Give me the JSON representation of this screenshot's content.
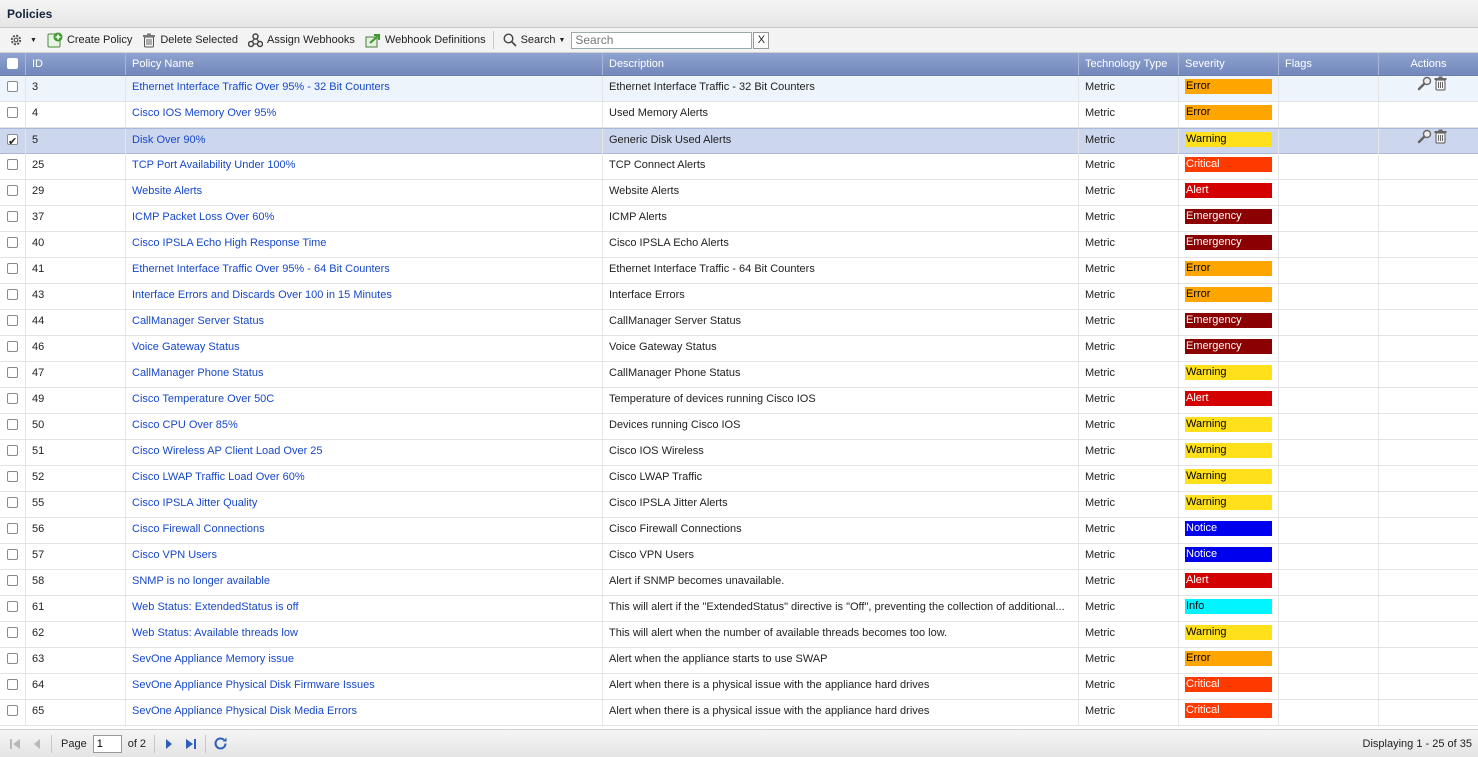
{
  "panel": {
    "title": "Policies"
  },
  "toolbar": {
    "create_label": "Create Policy",
    "delete_label": "Delete Selected",
    "assign_webhooks_label": "Assign Webhooks",
    "webhook_definitions_label": "Webhook Definitions",
    "search_menu_label": "Search",
    "search_placeholder": "Search",
    "search_clear": "X"
  },
  "columns": {
    "id": "ID",
    "name": "Policy Name",
    "description": "Description",
    "tech": "Technology Type",
    "severity": "Severity",
    "flags": "Flags",
    "actions": "Actions"
  },
  "severity_colors": {
    "Error": "#ffa500",
    "Warning": "#ffe01a",
    "Critical": "#ff3a00",
    "Alert": "#d40000",
    "Emergency": "#8b0000",
    "Notice": "#0000ee",
    "Info": "#00f5ff"
  },
  "rows": [
    {
      "id": "3",
      "name": "Ethernet Interface Traffic Over 95% - 32 Bit Counters",
      "description": "Ethernet Interface Traffic - 32 Bit Counters",
      "tech": "Metric",
      "severity": "Error",
      "flags": "",
      "checked": false,
      "actions": true,
      "style": "alt"
    },
    {
      "id": "4",
      "name": "Cisco IOS Memory Over 95%",
      "description": "Used Memory Alerts",
      "tech": "Metric",
      "severity": "Error",
      "flags": "",
      "checked": false,
      "actions": false,
      "style": ""
    },
    {
      "id": "5",
      "name": "Disk Over 90%",
      "description": "Generic Disk Used Alerts",
      "tech": "Metric",
      "severity": "Warning",
      "flags": "",
      "checked": true,
      "actions": true,
      "style": "selected"
    },
    {
      "id": "25",
      "name": "TCP Port Availability Under 100%",
      "description": "TCP Connect Alerts",
      "tech": "Metric",
      "severity": "Critical",
      "flags": "",
      "checked": false,
      "actions": false,
      "style": ""
    },
    {
      "id": "29",
      "name": "Website Alerts",
      "description": "Website Alerts",
      "tech": "Metric",
      "severity": "Alert",
      "flags": "",
      "checked": false,
      "actions": false,
      "style": ""
    },
    {
      "id": "37",
      "name": "ICMP Packet Loss Over 60%",
      "description": "ICMP Alerts",
      "tech": "Metric",
      "severity": "Emergency",
      "flags": "",
      "checked": false,
      "actions": false,
      "style": ""
    },
    {
      "id": "40",
      "name": "Cisco IPSLA Echo High Response Time",
      "description": "Cisco IPSLA Echo Alerts",
      "tech": "Metric",
      "severity": "Emergency",
      "flags": "",
      "checked": false,
      "actions": false,
      "style": ""
    },
    {
      "id": "41",
      "name": "Ethernet Interface Traffic Over 95% - 64 Bit Counters",
      "description": "Ethernet Interface Traffic - 64 Bit Counters",
      "tech": "Metric",
      "severity": "Error",
      "flags": "",
      "checked": false,
      "actions": false,
      "style": ""
    },
    {
      "id": "43",
      "name": "Interface Errors and Discards Over 100 in 15 Minutes",
      "description": "Interface Errors",
      "tech": "Metric",
      "severity": "Error",
      "flags": "",
      "checked": false,
      "actions": false,
      "style": ""
    },
    {
      "id": "44",
      "name": "CallManager Server Status",
      "description": "CallManager Server Status",
      "tech": "Metric",
      "severity": "Emergency",
      "flags": "",
      "checked": false,
      "actions": false,
      "style": ""
    },
    {
      "id": "46",
      "name": "Voice Gateway Status",
      "description": "Voice Gateway Status",
      "tech": "Metric",
      "severity": "Emergency",
      "flags": "",
      "checked": false,
      "actions": false,
      "style": ""
    },
    {
      "id": "47",
      "name": "CallManager Phone Status",
      "description": "CallManager Phone Status",
      "tech": "Metric",
      "severity": "Warning",
      "flags": "",
      "checked": false,
      "actions": false,
      "style": ""
    },
    {
      "id": "49",
      "name": "Cisco Temperature Over 50C",
      "description": "Temperature of devices running Cisco IOS",
      "tech": "Metric",
      "severity": "Alert",
      "flags": "",
      "checked": false,
      "actions": false,
      "style": ""
    },
    {
      "id": "50",
      "name": "Cisco CPU Over 85%",
      "description": "Devices running Cisco IOS",
      "tech": "Metric",
      "severity": "Warning",
      "flags": "",
      "checked": false,
      "actions": false,
      "style": ""
    },
    {
      "id": "51",
      "name": "Cisco Wireless AP Client Load Over 25",
      "description": "Cisco IOS Wireless",
      "tech": "Metric",
      "severity": "Warning",
      "flags": "",
      "checked": false,
      "actions": false,
      "style": ""
    },
    {
      "id": "52",
      "name": "Cisco LWAP Traffic Load Over 60%",
      "description": "Cisco LWAP Traffic",
      "tech": "Metric",
      "severity": "Warning",
      "flags": "",
      "checked": false,
      "actions": false,
      "style": ""
    },
    {
      "id": "55",
      "name": "Cisco IPSLA Jitter Quality",
      "description": "Cisco IPSLA Jitter Alerts",
      "tech": "Metric",
      "severity": "Warning",
      "flags": "",
      "checked": false,
      "actions": false,
      "style": ""
    },
    {
      "id": "56",
      "name": "Cisco Firewall Connections",
      "description": "Cisco Firewall Connections",
      "tech": "Metric",
      "severity": "Notice",
      "flags": "",
      "checked": false,
      "actions": false,
      "style": ""
    },
    {
      "id": "57",
      "name": "Cisco VPN Users",
      "description": "Cisco VPN Users",
      "tech": "Metric",
      "severity": "Notice",
      "flags": "",
      "checked": false,
      "actions": false,
      "style": ""
    },
    {
      "id": "58",
      "name": "SNMP is no longer available",
      "description": "Alert if SNMP becomes unavailable.",
      "tech": "Metric",
      "severity": "Alert",
      "flags": "",
      "checked": false,
      "actions": false,
      "style": ""
    },
    {
      "id": "61",
      "name": "Web Status: ExtendedStatus is off",
      "description": "This will alert if the \"ExtendedStatus\" directive is \"Off\", preventing the collection of additional...",
      "tech": "Metric",
      "severity": "Info",
      "flags": "",
      "checked": false,
      "actions": false,
      "style": ""
    },
    {
      "id": "62",
      "name": "Web Status: Available threads low",
      "description": "This will alert when the number of available threads becomes too low.",
      "tech": "Metric",
      "severity": "Warning",
      "flags": "",
      "checked": false,
      "actions": false,
      "style": ""
    },
    {
      "id": "63",
      "name": "SevOne Appliance Memory issue",
      "description": "Alert when the appliance starts to use SWAP",
      "tech": "Metric",
      "severity": "Error",
      "flags": "",
      "checked": false,
      "actions": false,
      "style": ""
    },
    {
      "id": "64",
      "name": "SevOne Appliance Physical Disk Firmware Issues",
      "description": "Alert when there is a physical issue with the appliance hard drives",
      "tech": "Metric",
      "severity": "Critical",
      "flags": "",
      "checked": false,
      "actions": false,
      "style": ""
    },
    {
      "id": "65",
      "name": "SevOne Appliance Physical Disk Media Errors",
      "description": "Alert when there is a physical issue with the appliance hard drives",
      "tech": "Metric",
      "severity": "Critical",
      "flags": "",
      "checked": false,
      "actions": false,
      "style": ""
    }
  ],
  "pager": {
    "page_label": "Page",
    "current_page": "1",
    "of_label": "of 2",
    "displaying": "Displaying 1 - 25 of 35"
  }
}
